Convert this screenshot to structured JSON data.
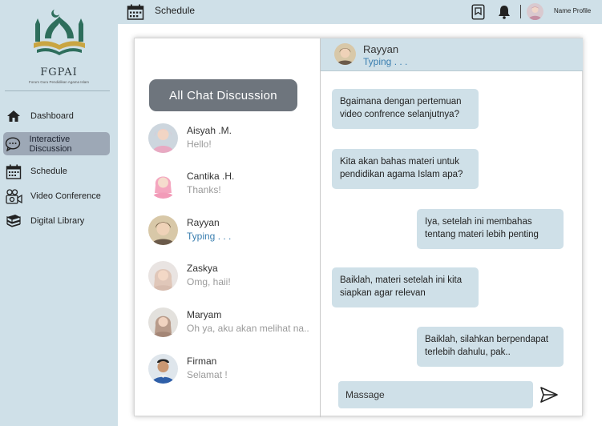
{
  "brand": {
    "name": "FGPAI",
    "tagline": "Forum Guru Pendidikan Agama Islam"
  },
  "sidebar": {
    "items": [
      {
        "label": "Dashboard",
        "icon": "home-icon"
      },
      {
        "label": "Interactive Discussion",
        "icon": "chat-icon",
        "active": true
      },
      {
        "label": "Schedule",
        "icon": "calendar-icon"
      },
      {
        "label": "Video Conference",
        "icon": "video-conference-icon"
      },
      {
        "label": "Digital Library",
        "icon": "books-icon"
      }
    ]
  },
  "topbar": {
    "title": "Schedule",
    "profile_name": "Name Profile"
  },
  "discussion": {
    "button_label": "All Chat Discussion",
    "contacts": [
      {
        "name": "Aisyah .M.",
        "last_message": "Hello!"
      },
      {
        "name": "Cantika .H.",
        "last_message": "Thanks!"
      },
      {
        "name": "Rayyan",
        "last_message": "Typing . . ."
      },
      {
        "name": "Zaskya",
        "last_message": "Omg, haii!"
      },
      {
        "name": "Maryam",
        "last_message": "Oh ya, aku akan melihat na.."
      },
      {
        "name": "Firman",
        "last_message": "Selamat !"
      }
    ]
  },
  "chat": {
    "contact_name": "Rayyan",
    "status": "Typing . . .",
    "messages": [
      {
        "side": "left",
        "text": "Bgaimana dengan pertemuan video confrence selanjutnya?"
      },
      {
        "side": "left",
        "text": "Kita akan bahas materi untuk pendidikan agama Islam apa?"
      },
      {
        "side": "right",
        "text": "Iya, setelah ini membahas tentang materi lebih penting"
      },
      {
        "side": "left",
        "text": "Baiklah, materi setelah ini kita siapkan agar relevan"
      },
      {
        "side": "right",
        "text": "Baiklah, silahkan berpendapat terlebih dahulu, pak.."
      }
    ],
    "input_placeholder": "Massage"
  },
  "colors": {
    "panel_bg": "#cfe0e8",
    "active_nav": "#9da8b6",
    "button": "#6e757d",
    "typing": "#3b7fb0",
    "logo_green": "#2e6e5c"
  }
}
